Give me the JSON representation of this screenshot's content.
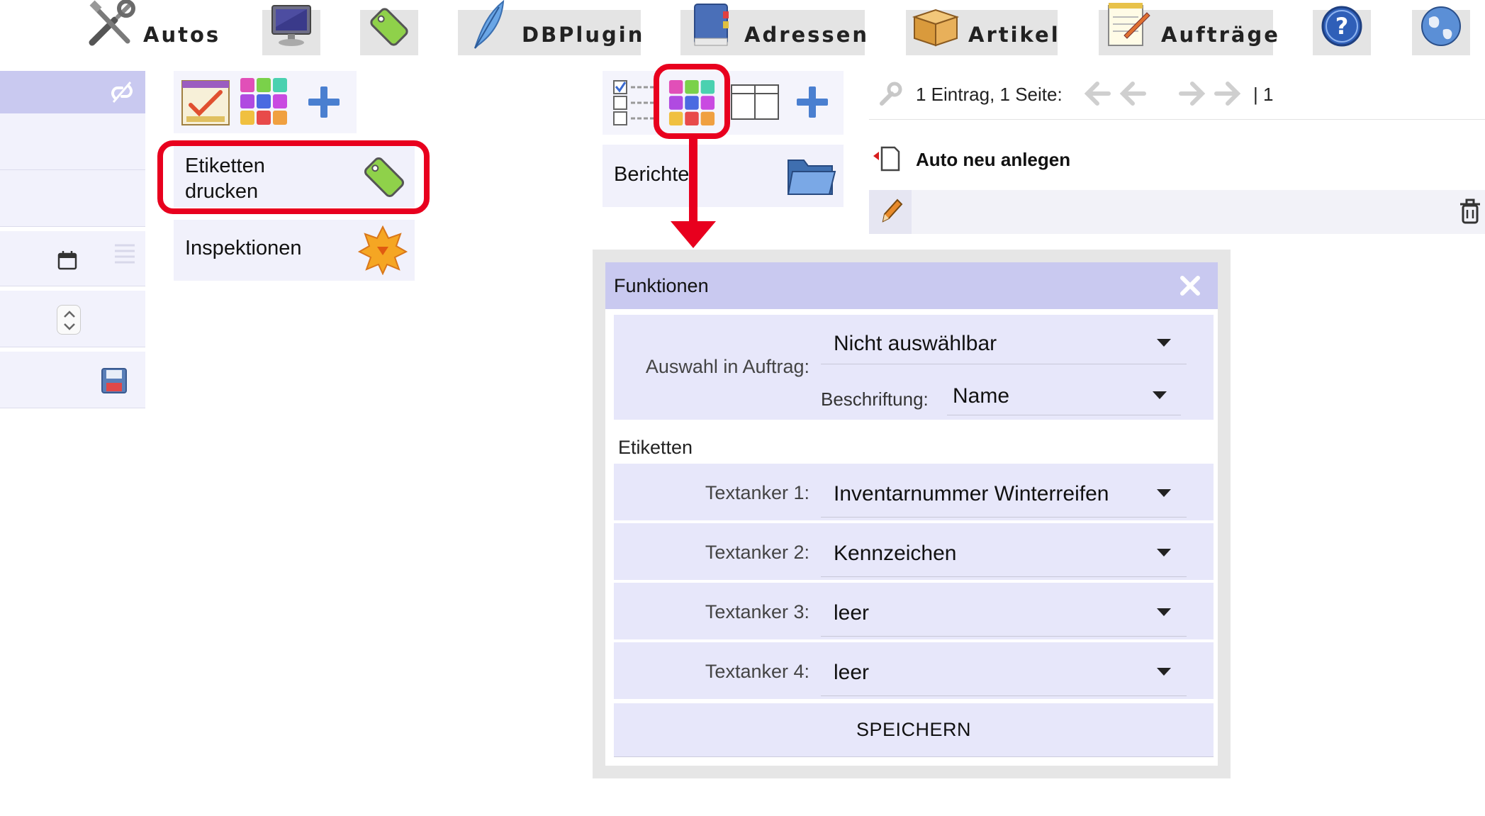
{
  "toolbar": {
    "autos_label": "Autos",
    "dbplugin_label": "DBPlugin",
    "adressen_label": "Adressen",
    "artikel_label": "Artikel",
    "auftraege_label": "Aufträge"
  },
  "menu": {
    "etiketten_line1": "Etiketten",
    "etiketten_line2": "drucken",
    "inspektionen": "Inspektionen",
    "berichte": "Berichte"
  },
  "pagination": {
    "info": "1 Eintrag, 1 Seite:",
    "pages": "| 1"
  },
  "record": {
    "new_label": "Auto neu anlegen"
  },
  "dialog": {
    "title": "Funktionen",
    "auswahl_label": "Auswahl in Auftrag:",
    "auswahl_value": "Nicht auswählbar",
    "beschriftung_label": "Beschriftung:",
    "beschriftung_value": "Name",
    "section_label": "Etiketten",
    "anchors": [
      {
        "label": "Textanker 1:",
        "value": "Inventarnummer Winterreifen"
      },
      {
        "label": "Textanker 2:",
        "value": "Kennzeichen"
      },
      {
        "label": "Textanker 3:",
        "value": "leer"
      },
      {
        "label": "Textanker 4:",
        "value": "leer"
      }
    ],
    "save_label": "SPEICHERN"
  },
  "colors": {
    "accent_lavender": "#c9c9f0",
    "highlight_red": "#e8001e"
  }
}
